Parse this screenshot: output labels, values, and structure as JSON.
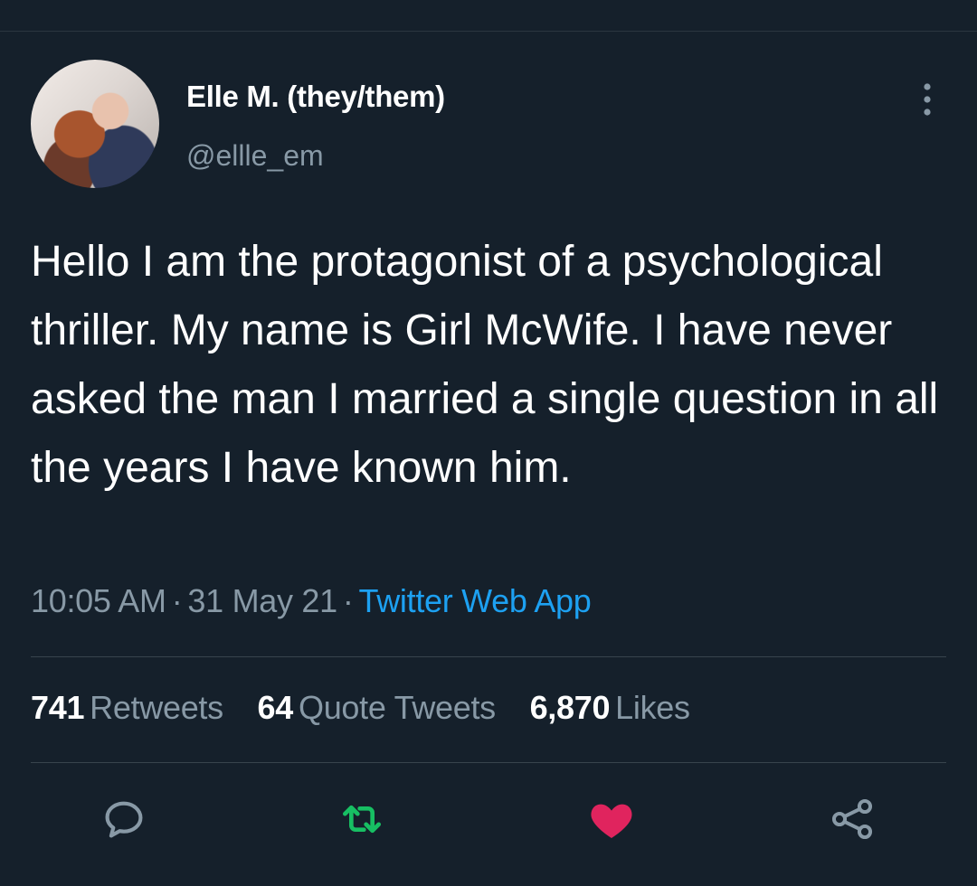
{
  "user": {
    "display_name": "Elle M. (they/them)",
    "handle": "@ellle_em"
  },
  "tweet": {
    "text": "Hello I am the protagonist of a psychological thriller. My name is Girl McWife. I have never asked the man I married a single question in all the years I have known him.",
    "time": "10:05 AM",
    "date": "31 May 21",
    "source": "Twitter Web App",
    "separator": "·"
  },
  "stats": {
    "retweets_count": "741",
    "retweets_label": "Retweets",
    "quotes_count": "64",
    "quotes_label": "Quote Tweets",
    "likes_count": "6,870",
    "likes_label": "Likes"
  },
  "actions": [
    {
      "icon": "reply-icon"
    },
    {
      "icon": "retweet-icon",
      "color": "#17bf63"
    },
    {
      "icon": "heart-icon",
      "color": "#e0245e",
      "liked": true
    },
    {
      "icon": "share-icon"
    }
  ],
  "colors": {
    "background": "#15202b",
    "secondary_text": "#8899a6",
    "link": "#1da1f2",
    "retweet": "#17bf63",
    "like": "#e0245e"
  }
}
